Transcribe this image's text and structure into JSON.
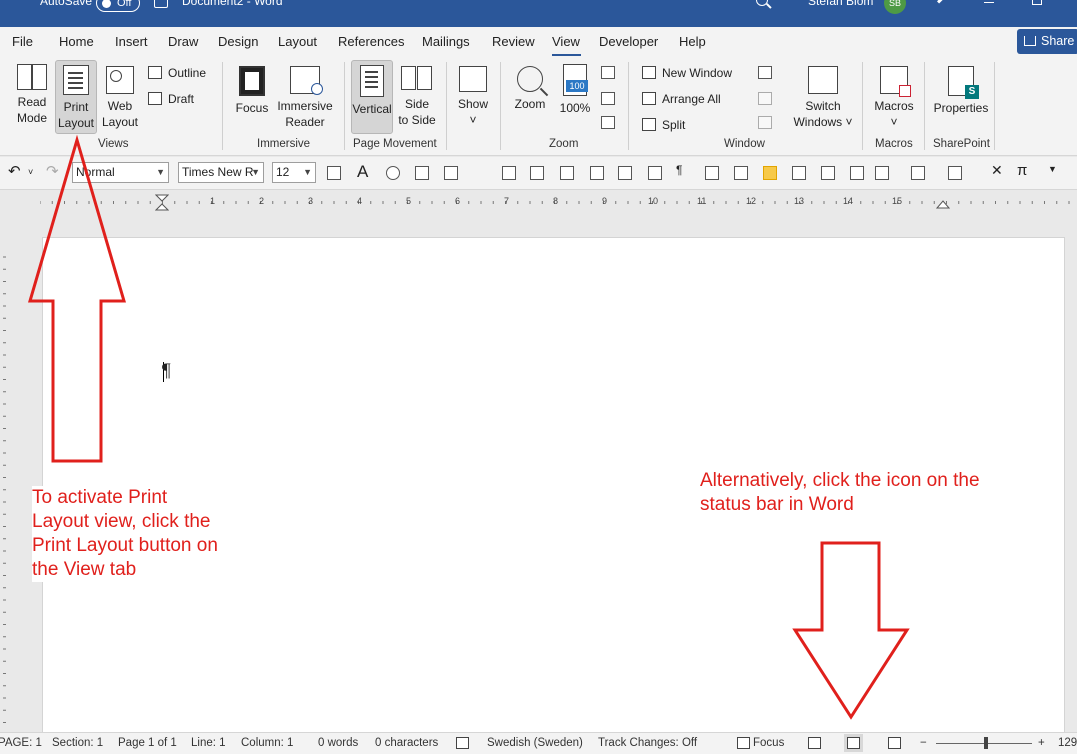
{
  "titlebar": {
    "autosave": "AutoSave",
    "autosave_state": "Off",
    "document": "Document2",
    "separator": "-",
    "app": "Word",
    "user": "Stefan Blom",
    "initials": "SB"
  },
  "tabs": [
    "File",
    "Home",
    "Insert",
    "Draw",
    "Design",
    "Layout",
    "References",
    "Mailings",
    "Review",
    "View",
    "Developer",
    "Help"
  ],
  "active_tab": "View",
  "share_label": "Share",
  "ribbon": {
    "views": {
      "read_mode": [
        "Read",
        "Mode"
      ],
      "print_layout": [
        "Print",
        "Layout"
      ],
      "web_layout": [
        "Web",
        "Layout"
      ],
      "outline": "Outline",
      "draft": "Draft",
      "label": "Views"
    },
    "immersive": {
      "focus": "Focus",
      "reader": [
        "Immersive",
        "Reader"
      ],
      "label": "Immersive"
    },
    "page_movement": {
      "vertical": "Vertical",
      "side": [
        "Side",
        "to Side"
      ],
      "label": "Page Movement"
    },
    "show": {
      "label": "Show"
    },
    "zoom": {
      "zoom": "Zoom",
      "hundred": "100%",
      "label": "Zoom"
    },
    "window": {
      "new_window": "New Window",
      "arrange_all": "Arrange All",
      "split": "Split",
      "switch": [
        "Switch",
        "Windows ˅"
      ],
      "label": "Window"
    },
    "macros": {
      "macros": "Macros",
      "label": "Macros"
    },
    "sharepoint": {
      "properties": "Properties",
      "label": "SharePoint"
    }
  },
  "format_toolbar": {
    "style": "Normal",
    "font": "Times New R",
    "size": "12"
  },
  "ruler_numbers": [
    "1",
    "2",
    "3",
    "4",
    "5",
    "6",
    "7",
    "8",
    "9",
    "10",
    "11",
    "12",
    "13",
    "14",
    "15",
    "16"
  ],
  "document": {
    "pilcrow": "¶"
  },
  "annotations": {
    "left": "To activate Print Layout view, click the Print Layout button on the View tab",
    "right": "Alternatively, click the icon on the status bar in Word"
  },
  "statusbar": {
    "page": "PAGE: 1",
    "section": "Section: 1",
    "page_of": "Page 1 of 1",
    "line": "Line: 1",
    "column": "Column: 1",
    "words": "0 words",
    "characters": "0 characters",
    "language": "Swedish (Sweden)",
    "track_changes": "Track Changes: Off",
    "focus": "Focus",
    "zoom_minus": "−",
    "zoom_plus": "+",
    "zoom_pct": "129"
  },
  "colors": {
    "title_bar": "#2b579a",
    "annotation": "#e0201c"
  },
  "icons": [
    "search-icon",
    "save-icon",
    "pen-icon",
    "minimize-icon",
    "maximize-icon",
    "undo-icon",
    "redo-icon",
    "arrow-icon"
  ]
}
